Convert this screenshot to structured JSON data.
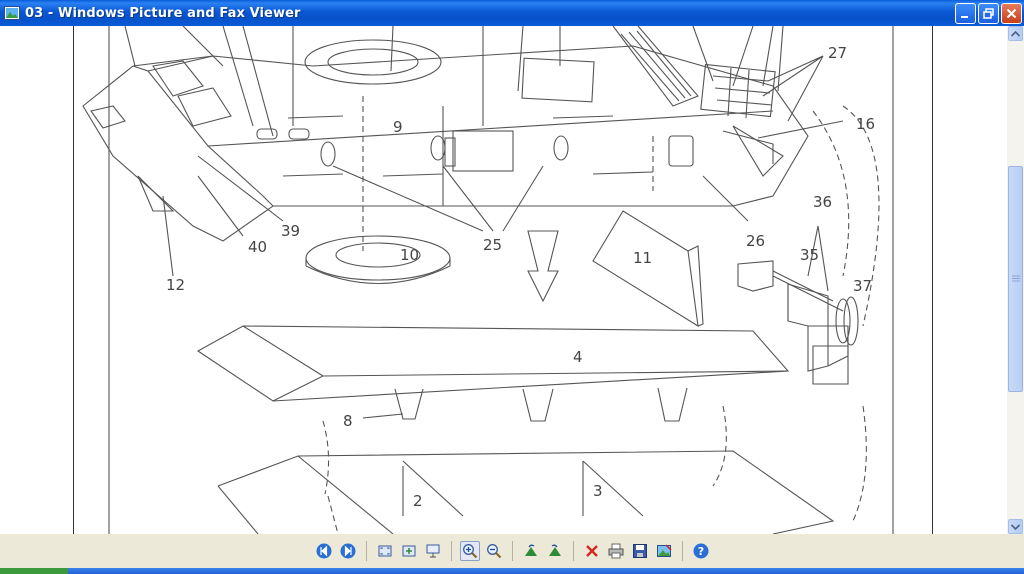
{
  "window": {
    "title": "03 - Windows Picture and Fax Viewer"
  },
  "diagram": {
    "labels": [
      "27",
      "16",
      "9",
      "39",
      "40",
      "12",
      "10",
      "25",
      "26",
      "11",
      "36",
      "35",
      "37",
      "4",
      "8",
      "2",
      "3"
    ]
  },
  "toolbar": {
    "buttons": [
      "previous-image",
      "next-image",
      "best-fit",
      "actual-size",
      "slideshow",
      "zoom-in",
      "zoom-out",
      "rotate-clockwise",
      "rotate-counterclockwise",
      "delete",
      "print",
      "save",
      "edit",
      "help"
    ]
  }
}
